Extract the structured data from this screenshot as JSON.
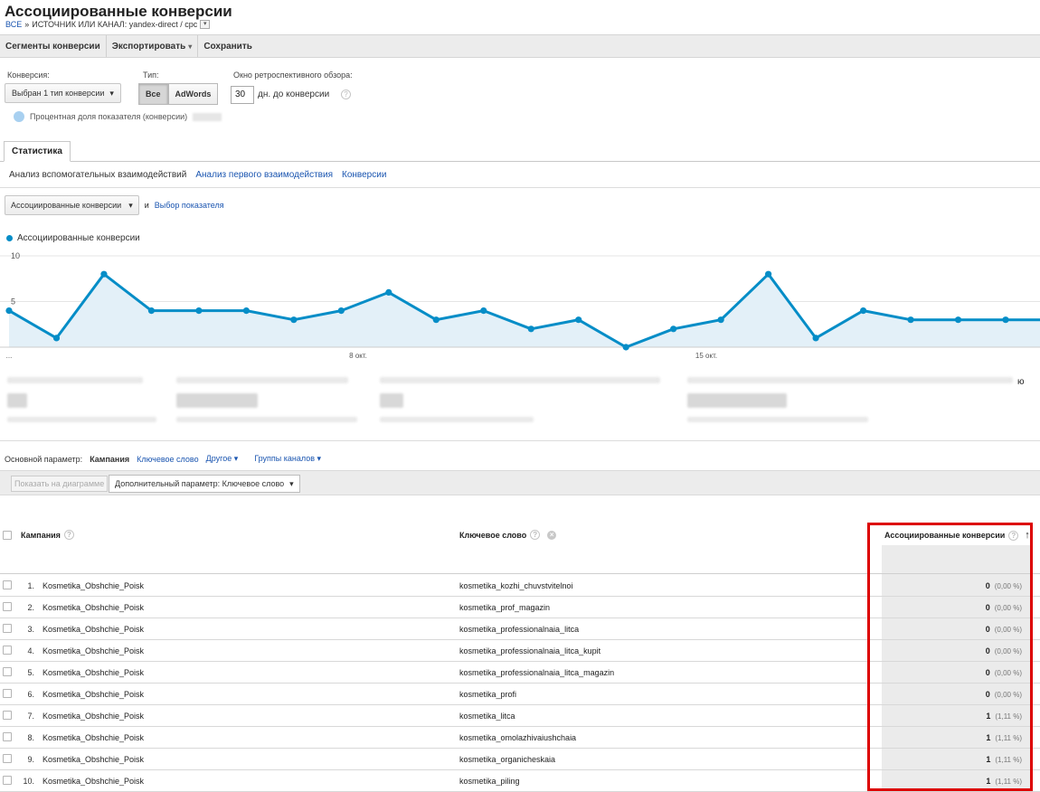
{
  "header": {
    "title": "Ассоциированные конверсии",
    "breadcrumb_root": "ВСЕ",
    "breadcrumb_sep": "»",
    "breadcrumb_filter": "ИСТОЧНИК ИЛИ КАНАЛ: yandex-direct / cpc"
  },
  "toolbar": {
    "segments": "Сегменты конверсии",
    "export": "Экспортировать",
    "save": "Сохранить"
  },
  "controls": {
    "conversion_label": "Конверсия:",
    "conversion_value": "Выбран 1 тип конверсии",
    "type_label": "Тип:",
    "type_all": "Все",
    "type_adwords": "AdWords",
    "lookback_label": "Окно ретроспективного обзора:",
    "lookback_value": "30",
    "lookback_suffix": "дн. до конверсии",
    "pct_note": "Процентная доля показателя (конверсии)"
  },
  "tabs": {
    "main": "Статистика",
    "sub": [
      "Анализ вспомогательных взаимодействий",
      "Анализ первого взаимодействия",
      "Конверсии"
    ]
  },
  "chart_controls": {
    "metric": "Ассоциированные конверсии",
    "and": "и",
    "select_metric": "Выбор показателя"
  },
  "chart_data": {
    "type": "area",
    "series": [
      {
        "name": "Ассоциированные конверсии",
        "values": [
          4,
          1,
          8,
          4,
          4,
          4,
          3,
          4,
          6,
          3,
          4,
          2,
          3,
          0,
          2,
          3,
          8,
          1,
          4,
          3,
          3,
          3
        ]
      }
    ],
    "y_ticks": [
      "10",
      "5"
    ],
    "ylim": [
      0,
      10
    ],
    "x_tick_labels": [
      "...",
      "8 окт.",
      "15 окт."
    ],
    "color": "#058dc7",
    "fill": "#e3f0f8"
  },
  "scorecards": {
    "overflow_char": "ю"
  },
  "dimensions": {
    "label": "Основной параметр:",
    "campaign": "Кампания",
    "keyword": "Ключевое слово",
    "other": "Другое",
    "channel_groups": "Группы каналов"
  },
  "table_controls": {
    "plot": "Показать на диаграмме",
    "secondary": "Дополнительный параметр: Ключевое слово"
  },
  "table": {
    "col_campaign": "Кампания",
    "col_keyword": "Ключевое слово",
    "col_metric": "Ассоциированные конверсии",
    "rows": [
      {
        "idx": "1.",
        "campaign": "Kosmetika_Obshchie_Poisk",
        "keyword": "kosmetika_kozhi_chuvstvitelnoi",
        "value": "0",
        "pct": "(0,00 %)"
      },
      {
        "idx": "2.",
        "campaign": "Kosmetika_Obshchie_Poisk",
        "keyword": "kosmetika_prof_magazin",
        "value": "0",
        "pct": "(0,00 %)"
      },
      {
        "idx": "3.",
        "campaign": "Kosmetika_Obshchie_Poisk",
        "keyword": "kosmetika_professionalnaia_litca",
        "value": "0",
        "pct": "(0,00 %)"
      },
      {
        "idx": "4.",
        "campaign": "Kosmetika_Obshchie_Poisk",
        "keyword": "kosmetika_professionalnaia_litca_kupit",
        "value": "0",
        "pct": "(0,00 %)"
      },
      {
        "idx": "5.",
        "campaign": "Kosmetika_Obshchie_Poisk",
        "keyword": "kosmetika_professionalnaia_litca_magazin",
        "value": "0",
        "pct": "(0,00 %)"
      },
      {
        "idx": "6.",
        "campaign": "Kosmetika_Obshchie_Poisk",
        "keyword": "kosmetika_profi",
        "value": "0",
        "pct": "(0,00 %)"
      },
      {
        "idx": "7.",
        "campaign": "Kosmetika_Obshchie_Poisk",
        "keyword": "kosmetika_litca",
        "value": "1",
        "pct": "(1,11 %)"
      },
      {
        "idx": "8.",
        "campaign": "Kosmetika_Obshchie_Poisk",
        "keyword": "kosmetika_omolazhivaiushchaia",
        "value": "1",
        "pct": "(1,11 %)"
      },
      {
        "idx": "9.",
        "campaign": "Kosmetika_Obshchie_Poisk",
        "keyword": "kosmetika_organicheskaia",
        "value": "1",
        "pct": "(1,11 %)"
      },
      {
        "idx": "10.",
        "campaign": "Kosmetika_Obshchie_Poisk",
        "keyword": "kosmetika_piling",
        "value": "1",
        "pct": "(1,11 %)"
      }
    ]
  },
  "colors": {
    "accent": "#058dc7",
    "link": "#1a55b0",
    "highlight_box": "#dd0000"
  }
}
